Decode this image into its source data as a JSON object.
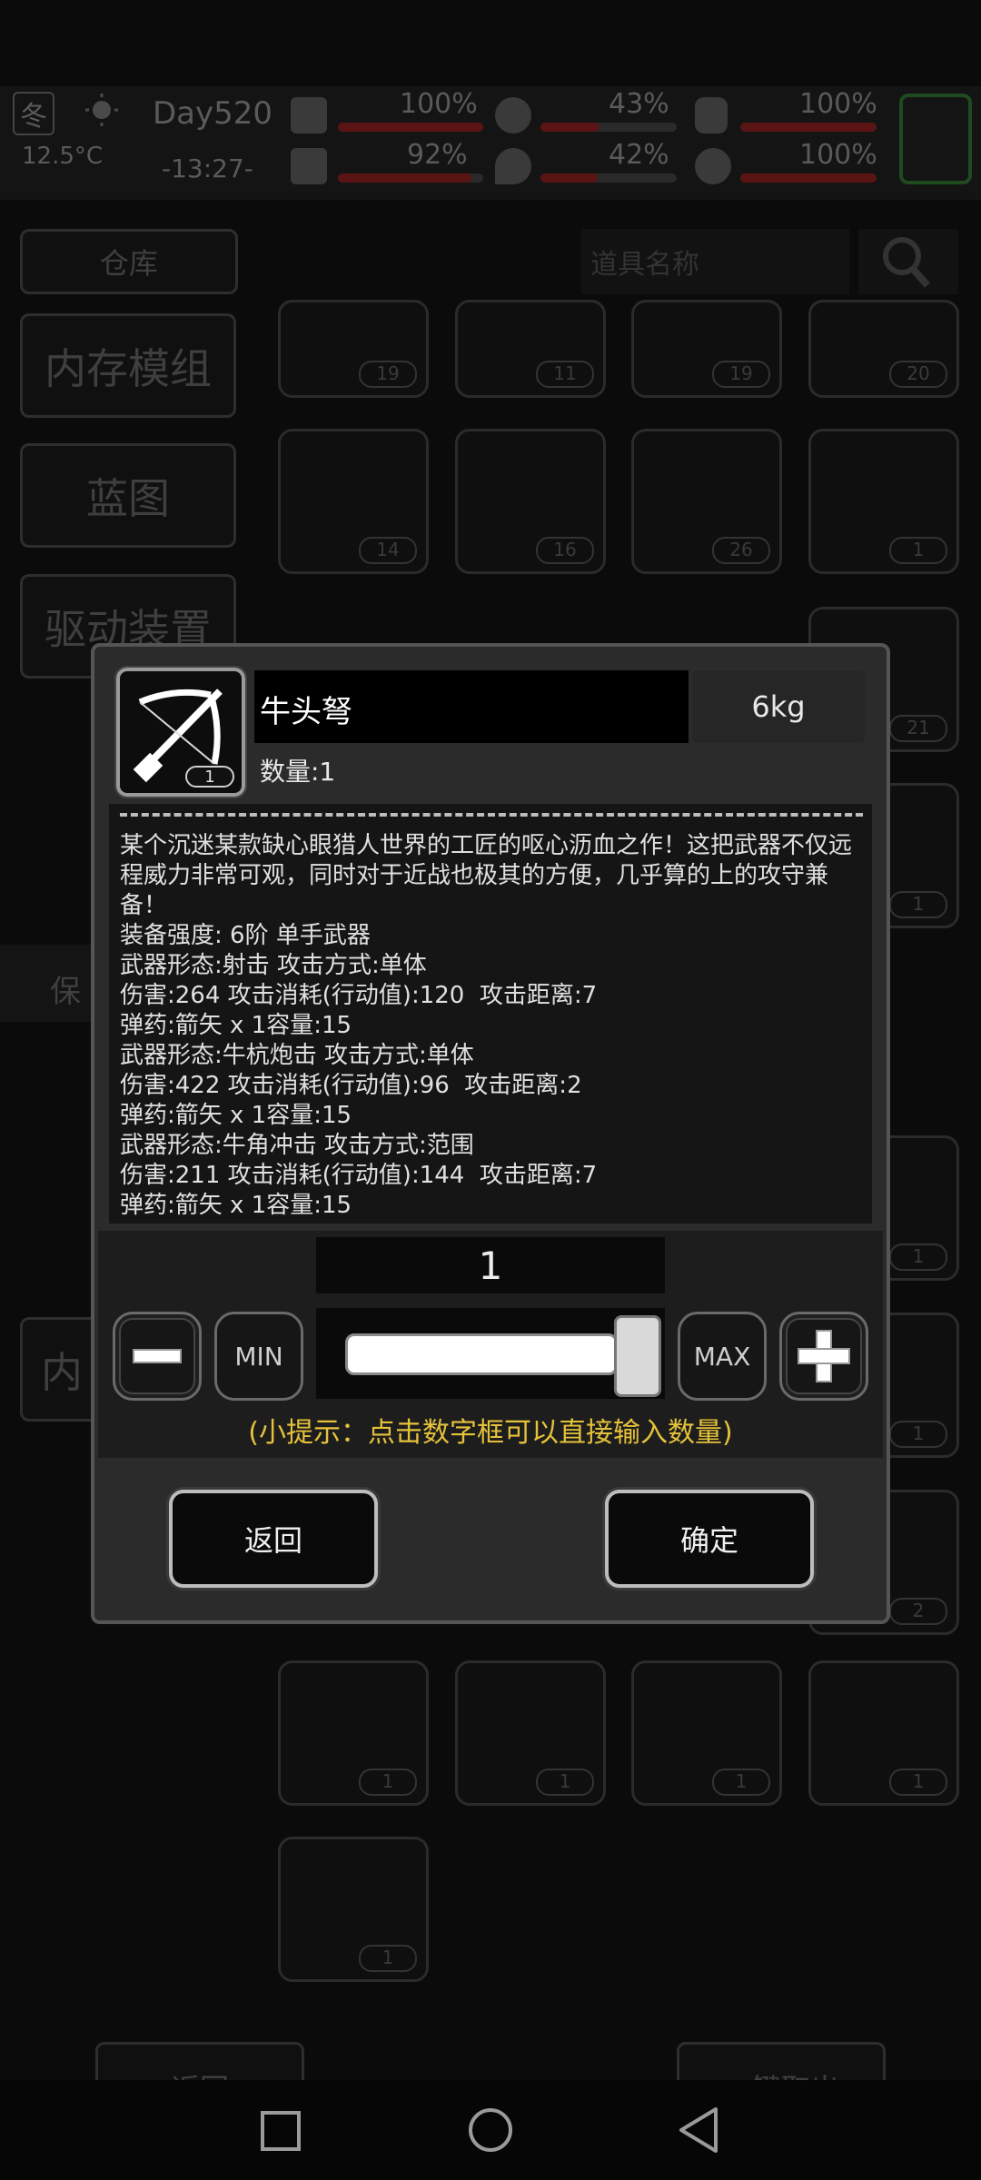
{
  "status": {
    "season": "冬",
    "temperature": "12.5°C",
    "day": "Day520",
    "time": "-13:27-",
    "stats": {
      "health_pct": "100%",
      "stomach_pct": "43%",
      "status3_pct": "100%",
      "stamina_pct": "92%",
      "water_pct": "42%",
      "mood_pct": "100%"
    }
  },
  "background": {
    "warehouse_tab": "仓库",
    "search_placeholder": "道具名称",
    "side_menu": [
      "内存模组",
      "蓝图",
      "驱动装置",
      "保",
      "内"
    ],
    "bottom_back": "返回",
    "bottom_takeout_all": "一键取出",
    "slot_counts_row1": [
      "19",
      "11",
      "19",
      "20"
    ],
    "slot_counts_row2": [
      "14",
      "16",
      "26",
      "1"
    ],
    "slot_counts_row3": [
      "1",
      "1",
      "1",
      "1"
    ],
    "slot_counts_row4": [
      "1"
    ],
    "slot_counts_right": [
      "21",
      "1",
      "1",
      "1",
      "1",
      "1",
      "2"
    ]
  },
  "dialog": {
    "item_name": "牛头弩",
    "item_icon_count": "1",
    "weight": "6kg",
    "quantity_label": "数量:1",
    "description": "某个沉迷某款缺心眼猎人世界的工匠的呕心沥血之作！这把武器不仅远程威力非常可观，同时对于近战也极其的方便，几乎算的上的攻守兼备！",
    "stats_lines": [
      "装备强度: 6阶 单手武器",
      "武器形态:射击 攻击方式:单体",
      "伤害:264 攻击消耗(行动值):120  攻击距离:7",
      "弹药:箭矢 x 1容量:15",
      "武器形态:牛杭炮击 攻击方式:单体",
      "伤害:422 攻击消耗(行动值):96  攻击距离:2",
      "弹药:箭矢 x 1容量:15",
      "武器形态:牛角冲击 攻击方式:范围",
      "伤害:211 攻击消耗(行动值):144  攻击距离:7",
      "弹药:箭矢 x 1容量:15"
    ],
    "quantity_value": "1",
    "min_label": "MIN",
    "max_label": "MAX",
    "slider_fraction": 1.0,
    "tip": "(小提示：点击数字框可以直接输入数量)",
    "back_label": "返回",
    "confirm_label": "确定",
    "tip_color": "#e6c23a"
  }
}
